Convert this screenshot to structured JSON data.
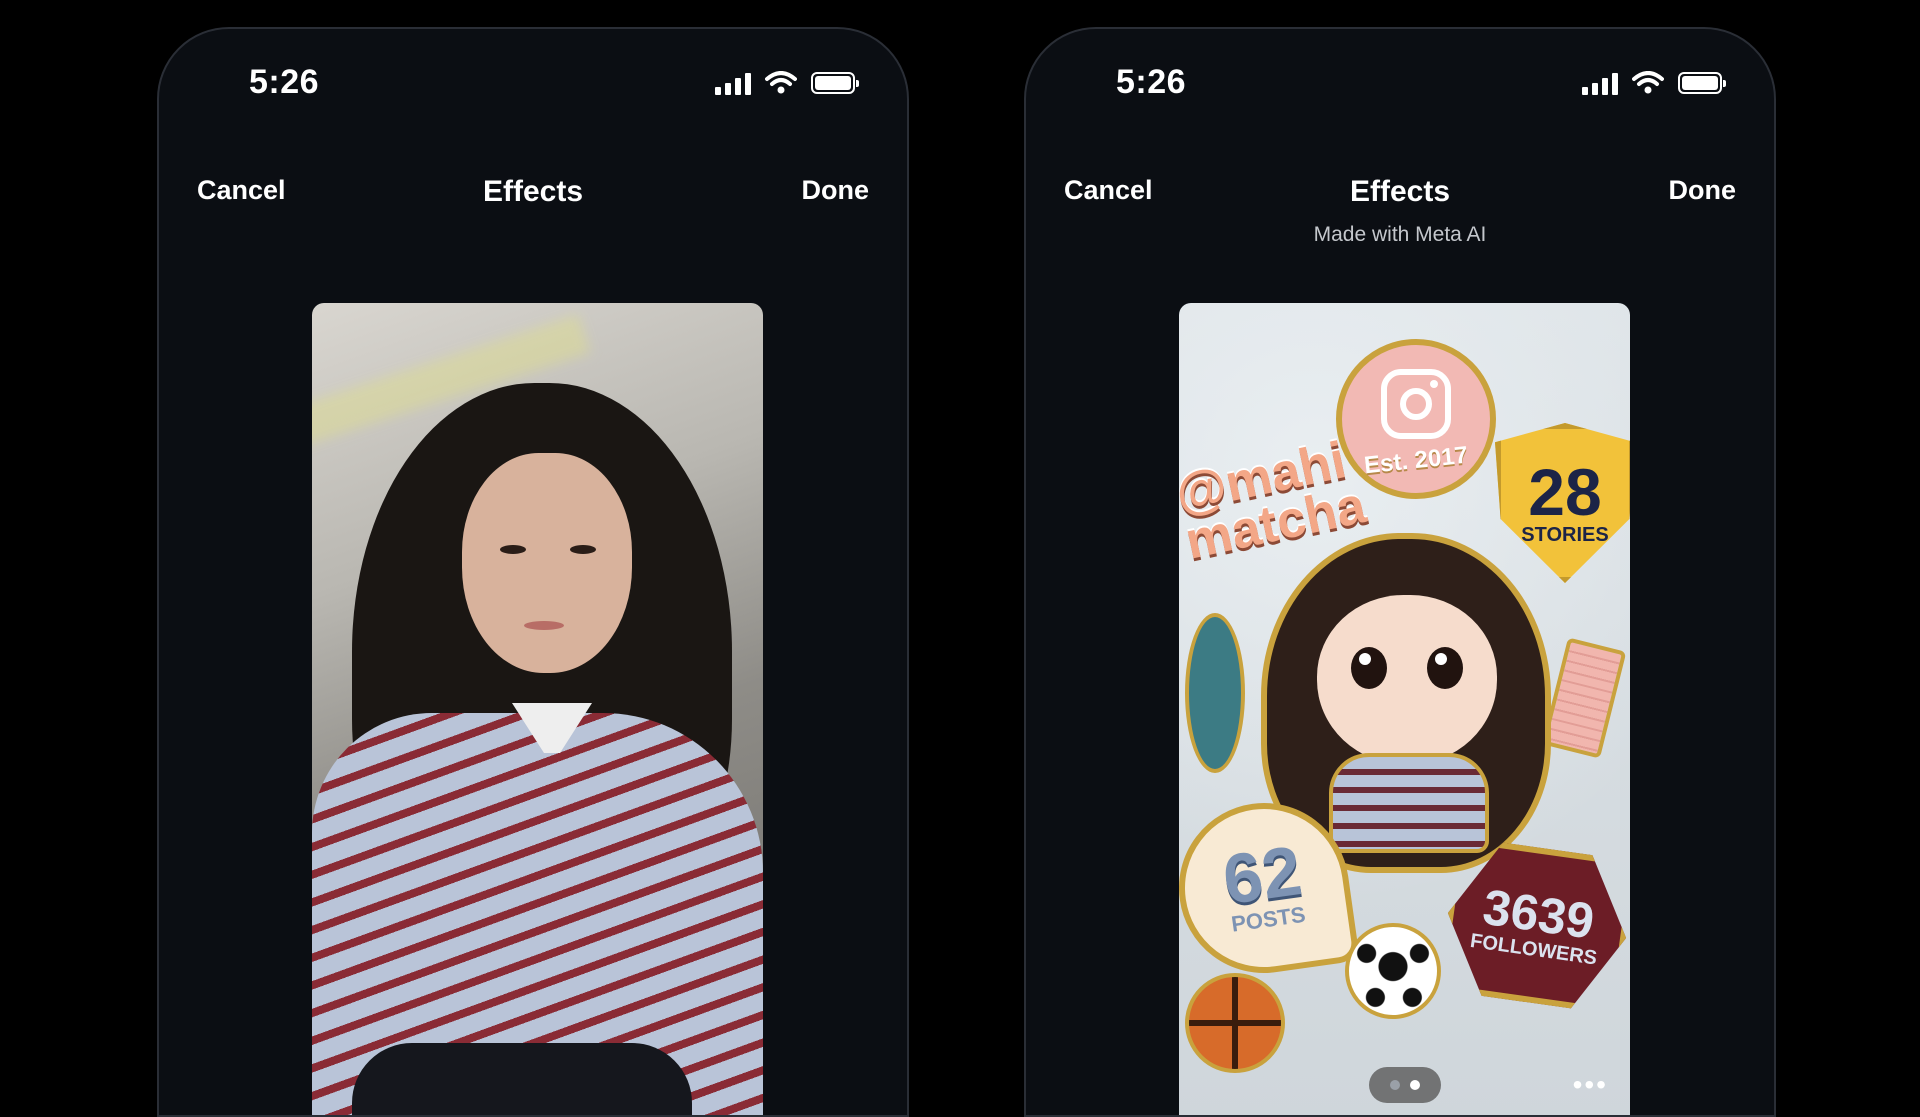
{
  "screens": [
    {
      "status": {
        "time": "5:26"
      },
      "nav": {
        "cancel": "Cancel",
        "title": "Effects",
        "done": "Done"
      },
      "image": {
        "icon": "original-selfie-photo"
      }
    },
    {
      "status": {
        "time": "5:26"
      },
      "nav": {
        "cancel": "Cancel",
        "title": "Effects",
        "subtitle": "Made with Meta AI",
        "done": "Done"
      },
      "image": {
        "icon": "ai-generated-pin-collage",
        "est_label": "Est. 2017",
        "handle": "@mahi matcha",
        "stories_count": "28",
        "stories_label": "STORIES",
        "posts_count": "62",
        "posts_label": "POSTS",
        "followers_count": "3639",
        "followers_label": "FOLLOWERS"
      },
      "pager": {
        "active_index": 1,
        "count": 2
      },
      "more_icon": "ellipsis-icon"
    }
  ],
  "colors": {
    "background": "#000000",
    "phone": "#0b0e13",
    "pin_gold": "#c9a23d"
  }
}
